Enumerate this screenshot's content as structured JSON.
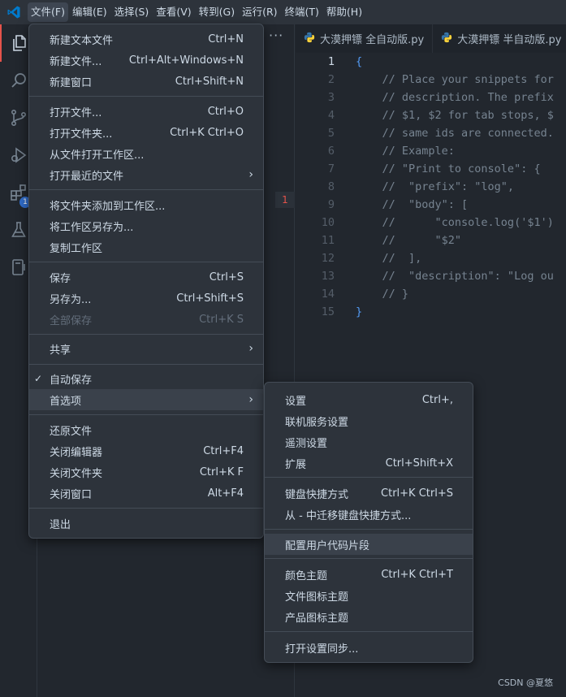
{
  "colors": {
    "accent_brand": "#007acc",
    "python_blue": "#3776ab",
    "python_yellow": "#ffd43b"
  },
  "menubar": [
    "文件(F)",
    "编辑(E)",
    "选择(S)",
    "查看(V)",
    "转到(G)",
    "运行(R)",
    "终端(T)",
    "帮助(H)"
  ],
  "activity_icons": [
    "explorer-icon",
    "search-icon",
    "source-control-icon",
    "run-debug-icon",
    "extensions-icon",
    "testing-icon",
    "remote-explorer-icon"
  ],
  "activity_badge": "1",
  "sidebar": {
    "more": "···",
    "problem_count": "1"
  },
  "tabs": [
    "大漠押镖 全自动版.py",
    "大漠押镖 半自动版.py"
  ],
  "editor_lines": [
    "{",
    "    // Place your snippets for",
    "    // description. The prefix",
    "    // $1, $2 for tab stops, $",
    "    // same ids are connected.",
    "    // Example:",
    "    // \"Print to console\": {",
    "    //  \"prefix\": \"log\",",
    "    //  \"body\": [",
    "    //      \"console.log('$1')",
    "    //      \"$2\"",
    "    //  ],",
    "    //  \"description\": \"Log ou",
    "    // }",
    "}"
  ],
  "file_menu": {
    "items": [
      {
        "label": "新建文本文件",
        "key": "Ctrl+N"
      },
      {
        "label": "新建文件...",
        "key": "Ctrl+Alt+Windows+N"
      },
      {
        "label": "新建窗口",
        "key": "Ctrl+Shift+N"
      },
      {
        "label": "打开文件...",
        "key": "Ctrl+O"
      },
      {
        "label": "打开文件夹...",
        "key": "Ctrl+K Ctrl+O"
      },
      {
        "label": "从文件打开工作区...",
        "key": ""
      },
      {
        "label": "打开最近的文件",
        "key": ""
      },
      {
        "label": "将文件夹添加到工作区...",
        "key": ""
      },
      {
        "label": "将工作区另存为...",
        "key": ""
      },
      {
        "label": "复制工作区",
        "key": ""
      },
      {
        "label": "保存",
        "key": "Ctrl+S"
      },
      {
        "label": "另存为...",
        "key": "Ctrl+Shift+S"
      },
      {
        "label": "全部保存",
        "key": "Ctrl+K S"
      },
      {
        "label": "共享",
        "key": ""
      },
      {
        "label": "自动保存",
        "key": ""
      },
      {
        "label": "首选项",
        "key": ""
      },
      {
        "label": "还原文件",
        "key": ""
      },
      {
        "label": "关闭编辑器",
        "key": "Ctrl+F4"
      },
      {
        "label": "关闭文件夹",
        "key": "Ctrl+K F"
      },
      {
        "label": "关闭窗口",
        "key": "Alt+F4"
      },
      {
        "label": "退出",
        "key": ""
      }
    ],
    "check_mark": "✓",
    "submenu_arrow": "›"
  },
  "pref_menu": {
    "items": [
      {
        "label": "设置",
        "key": "Ctrl+,"
      },
      {
        "label": "联机服务设置",
        "key": ""
      },
      {
        "label": "遥测设置",
        "key": ""
      },
      {
        "label": "扩展",
        "key": "Ctrl+Shift+X"
      },
      {
        "label": "键盘快捷方式",
        "key": "Ctrl+K Ctrl+S"
      },
      {
        "label": "从 - 中迁移键盘快捷方式...",
        "key": ""
      },
      {
        "label": "配置用户代码片段",
        "key": ""
      },
      {
        "label": "颜色主题",
        "key": "Ctrl+K Ctrl+T"
      },
      {
        "label": "文件图标主题",
        "key": ""
      },
      {
        "label": "产品图标主题",
        "key": ""
      },
      {
        "label": "打开设置同步...",
        "key": ""
      }
    ]
  },
  "footer": "CSDN @夏悠"
}
